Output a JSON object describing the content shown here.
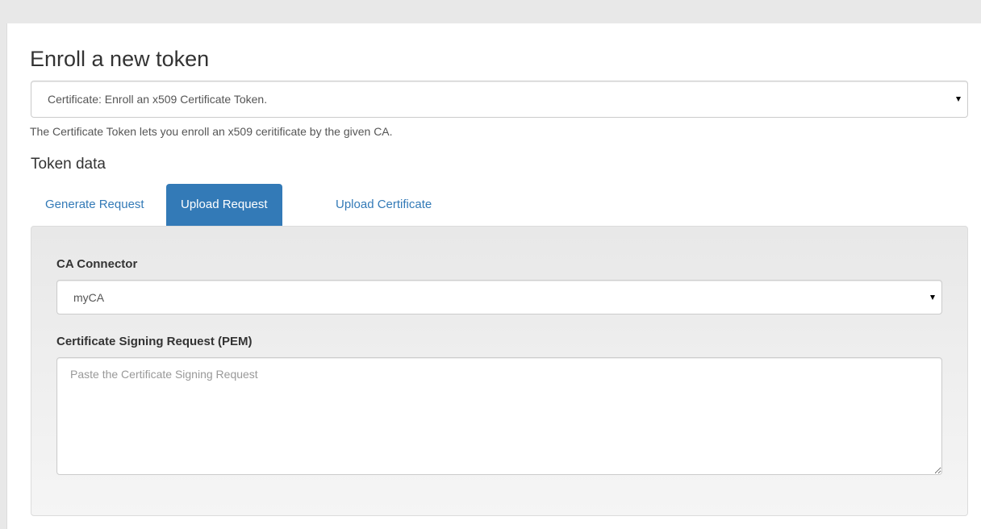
{
  "page": {
    "title": "Enroll a new token"
  },
  "token_type": {
    "selected": "Certificate: Enroll an x509 Certificate Token."
  },
  "description": "The Certificate Token lets you enroll an x509 ceritificate by the given CA.",
  "token_data": {
    "title": "Token data",
    "tabs": [
      {
        "label": "Generate Request",
        "active": false
      },
      {
        "label": "Upload Request",
        "active": true
      },
      {
        "label": "Upload Certificate",
        "active": false
      }
    ]
  },
  "form": {
    "ca_connector_label": "CA Connector",
    "ca_connector_value": "myCA",
    "csr_label": "Certificate Signing Request (PEM)",
    "csr_placeholder": "Paste the Certificate Signing Request",
    "csr_value": ""
  },
  "colors": {
    "accent": "#337ab7",
    "page_background": "#e8e8e8",
    "panel_background": "#ffffff"
  }
}
